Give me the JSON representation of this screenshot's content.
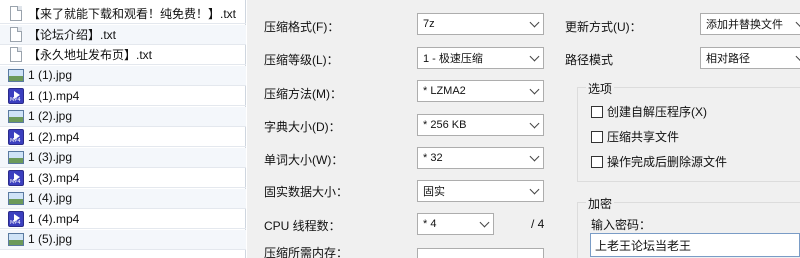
{
  "files": [
    {
      "icon": "txt-file-icon",
      "name": "【来了就能下载和观看！纯免费！】.txt"
    },
    {
      "icon": "txt-file-icon",
      "name": "【论坛介绍】.txt"
    },
    {
      "icon": "txt-file-icon",
      "name": "【永久地址发布页】.txt"
    },
    {
      "icon": "jpg-file-icon",
      "name": "1 (1).jpg"
    },
    {
      "icon": "mp4-file-icon",
      "name": "1 (1).mp4"
    },
    {
      "icon": "jpg-file-icon",
      "name": "1 (2).jpg"
    },
    {
      "icon": "mp4-file-icon",
      "name": "1 (2).mp4"
    },
    {
      "icon": "jpg-file-icon",
      "name": "1 (3).jpg"
    },
    {
      "icon": "mp4-file-icon",
      "name": "1 (3).mp4"
    },
    {
      "icon": "jpg-file-icon",
      "name": "1 (4).jpg"
    },
    {
      "icon": "mp4-file-icon",
      "name": "1 (4).mp4"
    },
    {
      "icon": "jpg-file-icon",
      "name": "1 (5).jpg"
    }
  ],
  "mp4_badge": "MP4",
  "compression": {
    "format_label": "压缩格式(F)：",
    "format_value": "7z",
    "level_label": "压缩等级(L)：",
    "level_value": "1 - 极速压缩",
    "method_label": "压缩方法(M)：",
    "method_value": "* LZMA2",
    "dict_label": "字典大小(D)：",
    "dict_value": "* 256 KB",
    "word_label": "单词大小(W)：",
    "word_value": "* 32",
    "solid_label": "固实数据大小：",
    "solid_value": "固实",
    "threads_label": "CPU 线程数：",
    "threads_value": "* 4",
    "threads_total": "/ 4",
    "memory_label": "压缩所需内存："
  },
  "update": {
    "mode_label": "更新方式(U)：",
    "mode_value": "添加并替换文件",
    "path_label": "路径模式",
    "path_value": "相对路径"
  },
  "options": {
    "title": "选项",
    "sfx": "创建自解压程序(X)",
    "shared": "压缩共享文件",
    "delete": "操作完成后删除源文件"
  },
  "encryption": {
    "title": "加密",
    "password_label": "输入密码：",
    "password_value": "上老王论坛当老王"
  }
}
